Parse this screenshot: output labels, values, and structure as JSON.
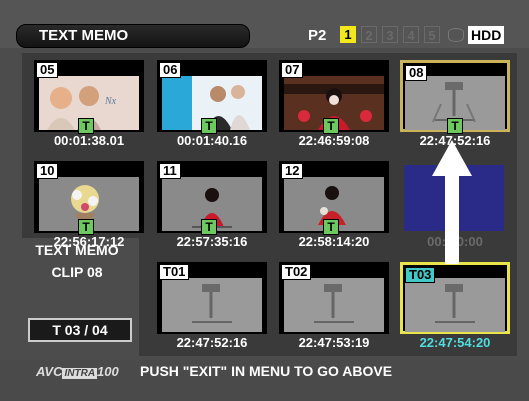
{
  "header": {
    "title": "TEXT MEMO",
    "media_label": "P2",
    "slots": [
      "1",
      "2",
      "3",
      "4",
      "5"
    ],
    "hdd_label": "HDD"
  },
  "clips": [
    {
      "num": "05",
      "badge": "T",
      "timecode": "00:01:38.01"
    },
    {
      "num": "06",
      "badge": "T",
      "timecode": "00:01:40.16"
    },
    {
      "num": "07",
      "badge": "T",
      "timecode": "22:46:59:08"
    },
    {
      "num": "08",
      "badge": "T",
      "timecode": "22:47:52:16"
    },
    {
      "num": "10",
      "badge": "T",
      "timecode": "22:56:17:12"
    },
    {
      "num": "11",
      "badge": "T",
      "timecode": "22:57:35:16"
    },
    {
      "num": "12",
      "badge": "T",
      "timecode": "22:58:14:20"
    },
    {
      "num": "",
      "badge": "",
      "timecode": "00:0  0:00"
    }
  ],
  "memo_panel": {
    "title": "TEXT MEMO",
    "clip": "CLIP 08",
    "count": "T 03  /  04"
  },
  "memos": [
    {
      "num": "T01",
      "timecode": "22:47:52:16"
    },
    {
      "num": "T02",
      "timecode": "22:47:53:19"
    },
    {
      "num": "T03",
      "timecode": "22:47:54:20"
    }
  ],
  "footer": {
    "logo": "AVC",
    "logo_box": "INTRA",
    "logo_suffix": "100",
    "message": "PUSH \"EXIT\" IN MENU TO GO ABOVE"
  },
  "colors": {
    "active_slot": "#f3e81c",
    "selected_clip_border": "#cbb35a",
    "selected_memo_border": "#e8e44a",
    "selected_timecode": "#4fdede",
    "text_badge": "#6ec860"
  }
}
